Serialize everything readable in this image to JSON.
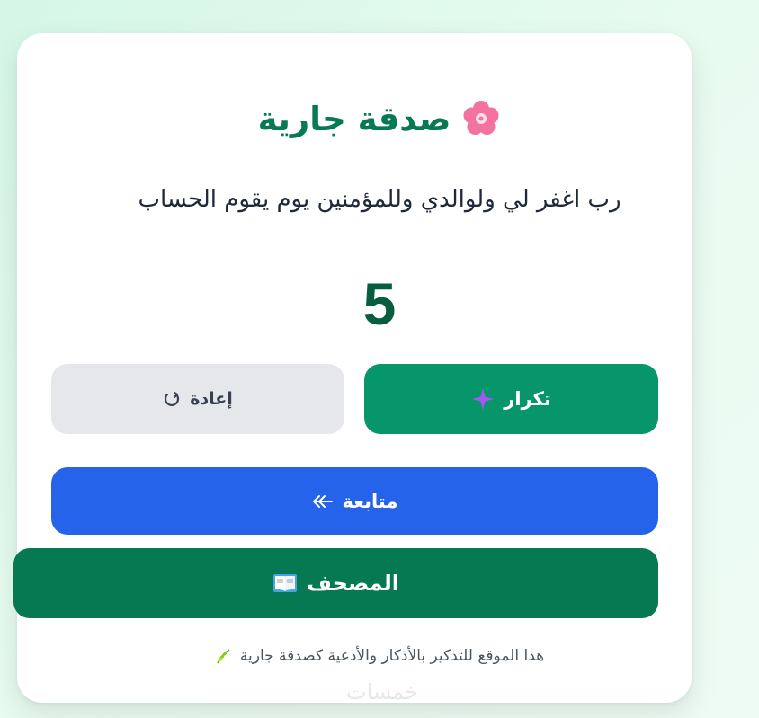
{
  "app": {
    "title": "صدقة جارية",
    "title_icon": "flower-icon",
    "dua": "رب اغفر لي ولوالدي وللمؤمنين يوم يقوم الحساب",
    "counter": "5"
  },
  "buttons": {
    "repeat_label": "تكرار",
    "repeat_icon": "sparkle-icon",
    "reset_label": "إعادة",
    "reset_icon": "reset-icon",
    "next_label": "متابعة",
    "next_icon": "arrow-icon",
    "mushaf_label": "المصحف",
    "mushaf_icon": "book-icon"
  },
  "footer": {
    "text": "هذا الموقع للتذكير بالأذكار والأدعية كصدقة جارية",
    "icon": "leaf-icon"
  },
  "watermark": "خمسات",
  "colors": {
    "title": "#077a55",
    "repeat": "#079669",
    "reset": "#e5e7eb",
    "next": "#2563eb",
    "mushaf": "#067852"
  }
}
